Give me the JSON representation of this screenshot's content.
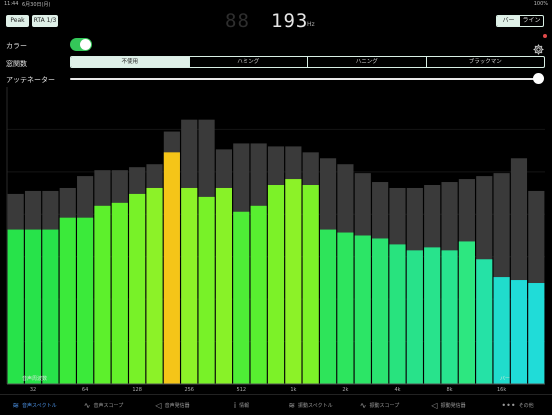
{
  "statusbar": {
    "time": "11:44",
    "date": "6月30日(月)",
    "battery": "100%"
  },
  "toolbar": {
    "peak_label": "Peak",
    "rta_label": "RTA 1/3",
    "freq_ghost": "88",
    "freq_value": "193",
    "freq_unit": "Hz",
    "view_options": [
      "バー",
      "ライン"
    ],
    "view_selected": 0
  },
  "settings": {
    "color_label": "カラー",
    "color_on": true,
    "window_label": "窓関数",
    "window_options": [
      "不使用",
      "ハミング",
      "ハニング",
      "ブラックマン"
    ],
    "window_selected": 0,
    "attenuator_label": "アッテネーター",
    "attenuator_value": 1.0
  },
  "chart_data": {
    "type": "bar",
    "ylim": [
      0,
      1
    ],
    "x_ticks": [
      "32",
      "64",
      "128",
      "256",
      "512",
      "1k",
      "2k",
      "4k",
      "8k",
      "16k"
    ],
    "tick_band_index": [
      1,
      4,
      7,
      10,
      13,
      16,
      19,
      22,
      25,
      28
    ],
    "corner_left": "音声周波数",
    "corner_right": "バー",
    "series": [
      {
        "name": "peak",
        "color": "#3a3a3a",
        "values": [
          0.64,
          0.65,
          0.65,
          0.66,
          0.7,
          0.72,
          0.72,
          0.73,
          0.74,
          0.85,
          0.89,
          0.89,
          0.79,
          0.81,
          0.81,
          0.8,
          0.8,
          0.78,
          0.76,
          0.74,
          0.71,
          0.68,
          0.66,
          0.66,
          0.67,
          0.68,
          0.69,
          0.7,
          0.71,
          0.76,
          0.65
        ]
      },
      {
        "name": "level",
        "values": [
          0.52,
          0.52,
          0.52,
          0.56,
          0.56,
          0.6,
          0.61,
          0.64,
          0.66,
          0.78,
          0.66,
          0.63,
          0.66,
          0.58,
          0.6,
          0.67,
          0.69,
          0.67,
          0.52,
          0.51,
          0.5,
          0.49,
          0.47,
          0.45,
          0.46,
          0.45,
          0.48,
          0.42,
          0.36,
          0.35,
          0.34
        ]
      }
    ],
    "colors": [
      "#27e34a",
      "#27e34a",
      "#27e34a",
      "#3bea3a",
      "#3bea3a",
      "#5df02c",
      "#64f02a",
      "#78f228",
      "#8cf228",
      "#f5c518",
      "#8cf228",
      "#78f228",
      "#88f228",
      "#4eed36",
      "#58ef30",
      "#7cf228",
      "#8cf228",
      "#7cf228",
      "#2ee45a",
      "#2de55e",
      "#2ce566",
      "#2ae370",
      "#28e37e",
      "#28e28a",
      "#28e38c",
      "#28e48e",
      "#2de780",
      "#25e2a6",
      "#20dccc",
      "#20dcd8",
      "#20dcd8"
    ]
  },
  "tabbar": {
    "items": [
      {
        "icon": "≋",
        "label": "音声スペクトル"
      },
      {
        "icon": "∿",
        "label": "音声スコープ"
      },
      {
        "icon": "◁",
        "label": "音声発信器"
      },
      {
        "icon": "i",
        "label": "情報"
      },
      {
        "icon": "≋",
        "label": "振動スペクトル"
      },
      {
        "icon": "∿",
        "label": "振動スコープ"
      },
      {
        "icon": "◁",
        "label": "振動発信器"
      },
      {
        "icon": "•••",
        "label": "その他"
      }
    ],
    "selected": 0,
    "accent": "#4a8fe0"
  }
}
